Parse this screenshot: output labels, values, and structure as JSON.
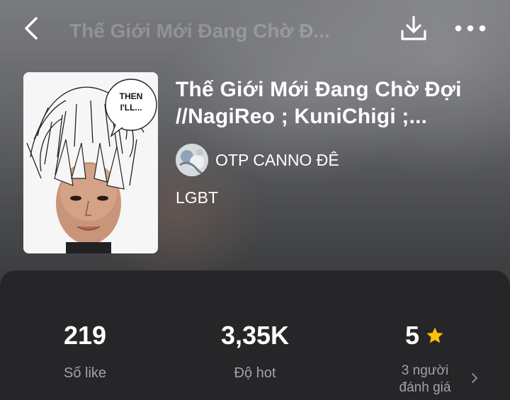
{
  "header": {
    "faded_title": "Thế Giới Mới Đang Chờ Đ...",
    "back_icon": "chevron-left-icon",
    "download_icon": "download-icon",
    "more_icon": "more-horizontal-icon"
  },
  "story": {
    "title": "Thế Giới Mới Đang Chờ Đợi //NagiReo ; KuniChigi ;...",
    "cover_bubble_text": "THEN I'LL...",
    "author": {
      "name": "OTP CANNO ĐÊ"
    },
    "genre": "LGBT"
  },
  "stats": {
    "likes": {
      "value": "219",
      "label": "Số like"
    },
    "hot": {
      "value": "3,35K",
      "label": "Độ hot"
    },
    "rating": {
      "value": "5",
      "label_line1": "3 người",
      "label_line2": "đánh giá",
      "star_color": "#FFC107"
    }
  },
  "colors": {
    "panel_bg": "#262628",
    "label_gray": "#A3A3A6",
    "text": "#FFFFFF"
  }
}
